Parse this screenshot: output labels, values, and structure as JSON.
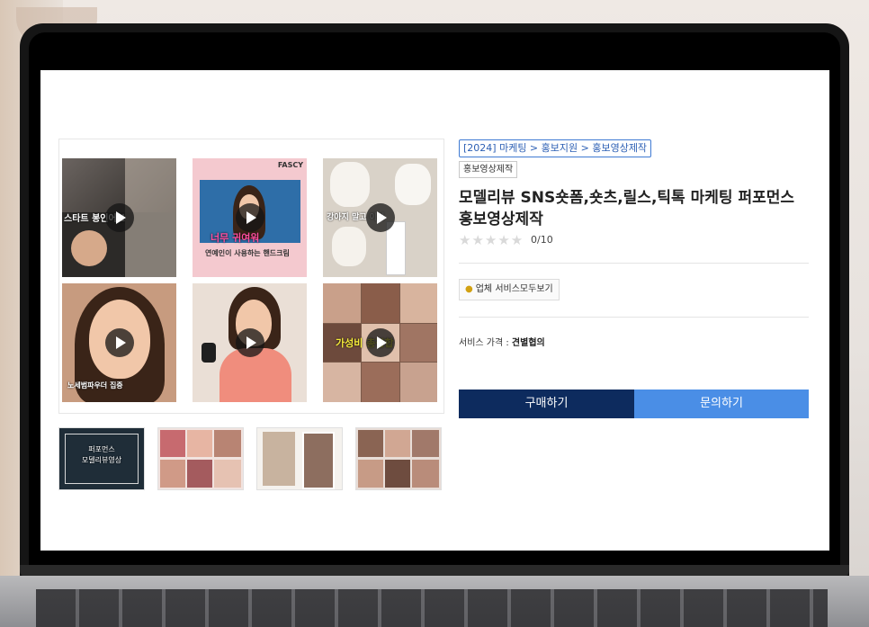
{
  "gallery": {
    "captions": {
      "t1": "스타트 봉인어보",
      "t2_top": "FASCY",
      "t2_bottom": "연예인이 사용하는 핸드크림",
      "t2_mid": "너무 귀여워",
      "t3": "강아지 말고 이거",
      "t4": "노세범파우더 집중",
      "t6": "가성비 총집합"
    },
    "small_1_lines": [
      "퍼포먼스",
      "모델리뷰영상"
    ]
  },
  "product": {
    "breadcrumb": "[2024] 마케팅 > 홍보지원 > 홍보영상제작",
    "tag": "홍보영상제작",
    "title": "모델리뷰 SNS숏폼,숏츠,릴스,틱톡 마케팅 퍼포먼스 홍보영상제작",
    "stars": "★★★★★",
    "rating": "0/10",
    "seller_button": "업체 서비스모두보기",
    "price_label": "서비스 가격 :",
    "price_value": "견별협의",
    "buy_button": "구매하기",
    "inquiry_button": "문의하기"
  },
  "colors": {
    "buy": "#0d2b5e",
    "inquiry": "#4a8ee6",
    "breadcrumb": "#2c5fb4"
  }
}
